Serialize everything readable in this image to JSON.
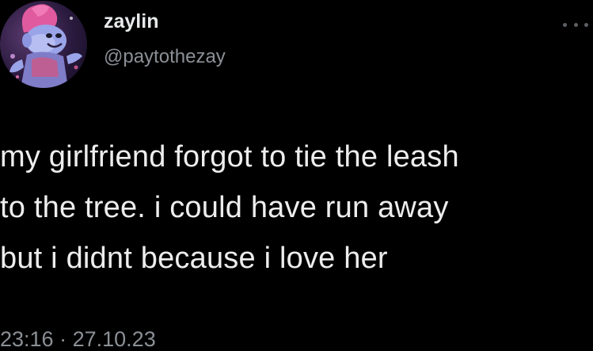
{
  "author": {
    "display_name": "zaylin",
    "handle": "@paytothezay",
    "avatar_icon": "troll-character-avatar"
  },
  "menu": {
    "icon": "more-options-icon"
  },
  "tweet": {
    "lines": [
      "my girlfriend forgot to tie the leash",
      "to the tree. i could have run away",
      "but i didnt because i love her"
    ]
  },
  "meta": {
    "time": "23:16",
    "separator": "·",
    "date": "27.10.23"
  },
  "colors": {
    "background": "#000000",
    "text": "#e7e9ea",
    "secondary": "#8b9096"
  }
}
